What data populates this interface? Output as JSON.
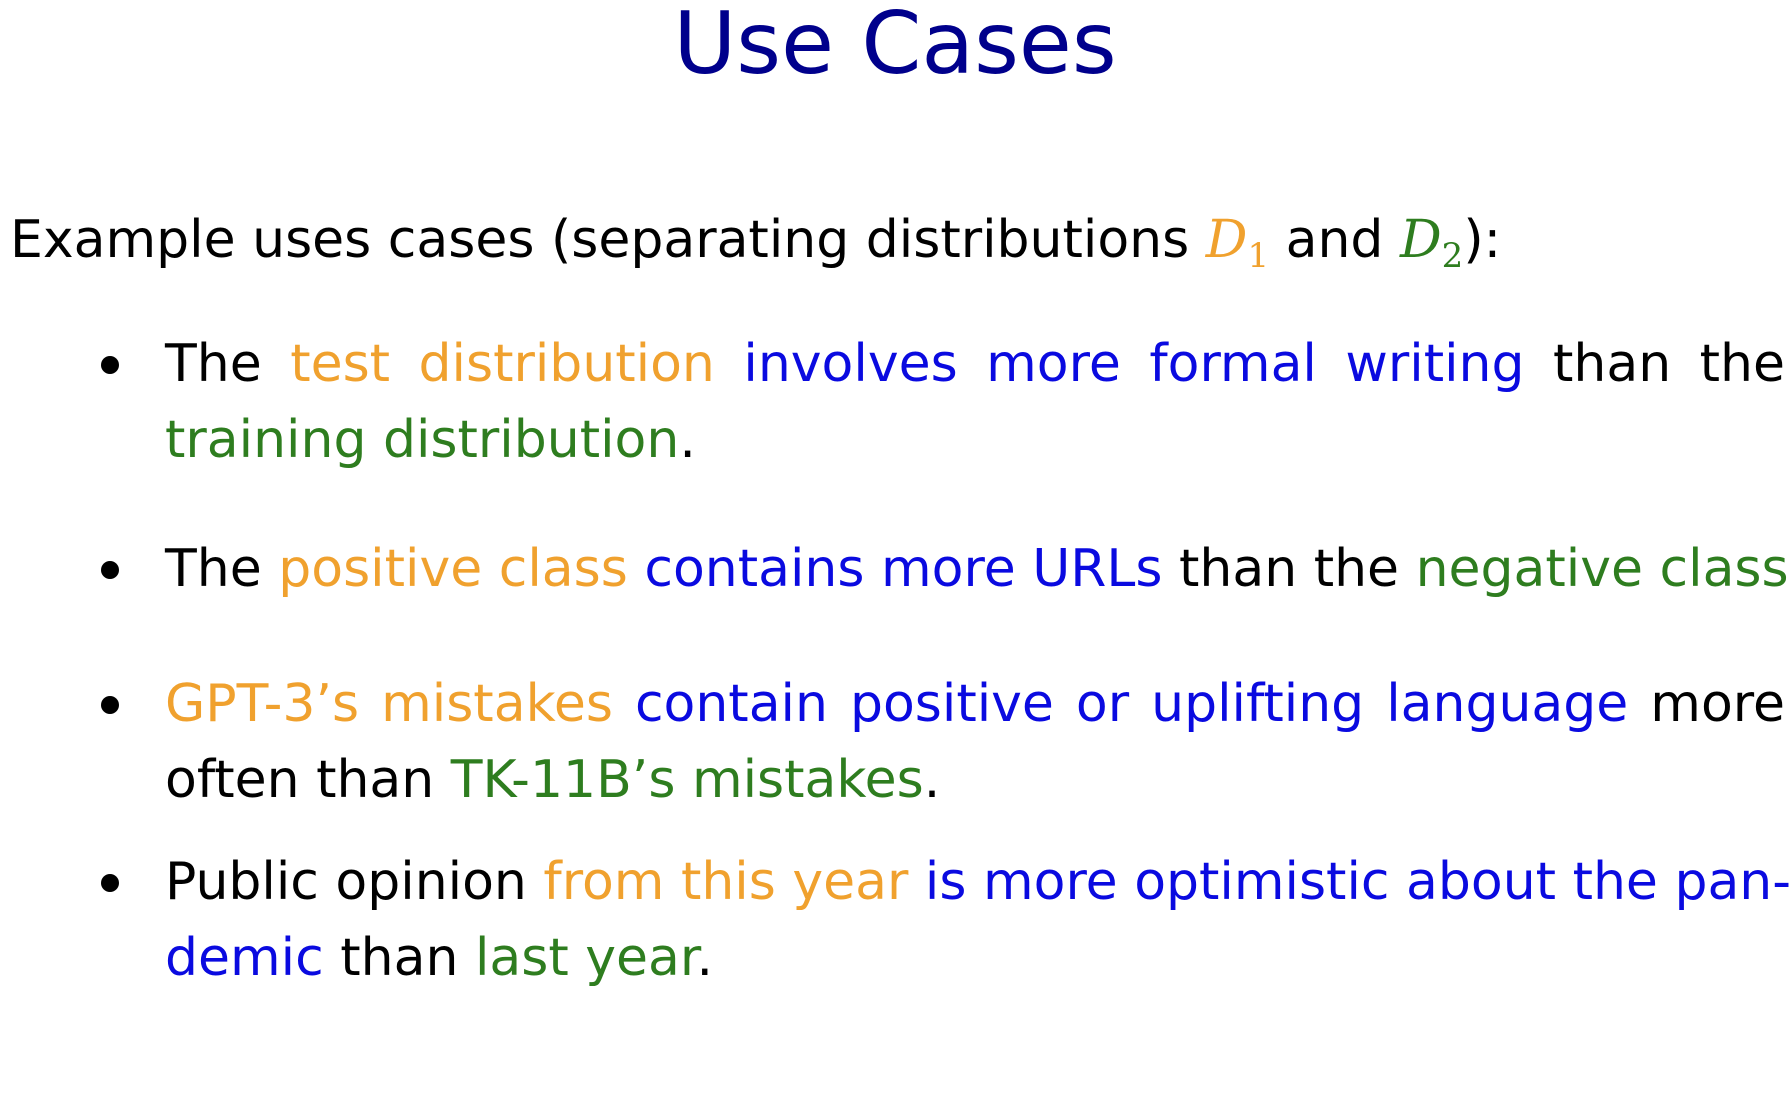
{
  "title": "Use Cases",
  "intro": {
    "prefix": "Example uses cases (separating distributions ",
    "d1": "D",
    "d1_sub": "1",
    "middle": " and ",
    "d2": "D",
    "d2_sub": "2",
    "suffix": "):"
  },
  "bullets": [
    {
      "lines": [
        [
          {
            "text": "The ",
            "color": "black"
          },
          {
            "text": "test distribution",
            "color": "orange"
          },
          {
            "text": " ",
            "color": "black"
          },
          {
            "text": "involves more formal writing",
            "color": "blue"
          },
          {
            "text": " than the",
            "color": "black"
          }
        ],
        [
          {
            "text": "training distribution",
            "color": "green"
          },
          {
            "text": ".",
            "color": "black"
          }
        ]
      ]
    },
    {
      "lines": [
        [
          {
            "text": "The ",
            "color": "black"
          },
          {
            "text": "positive class",
            "color": "orange"
          },
          {
            "text": " ",
            "color": "black"
          },
          {
            "text": "contains more URLs",
            "color": "blue"
          },
          {
            "text": " than the ",
            "color": "black"
          },
          {
            "text": "negative class",
            "color": "green"
          },
          {
            "text": ".",
            "color": "black"
          }
        ]
      ]
    },
    {
      "lines": [
        [
          {
            "text": "GPT-3’s mistakes",
            "color": "orange"
          },
          {
            "text": " ",
            "color": "black"
          },
          {
            "text": "contain positive or uplifting language",
            "color": "blue"
          },
          {
            "text": " more",
            "color": "black"
          }
        ],
        [
          {
            "text": "often than ",
            "color": "black"
          },
          {
            "text": "TK-11B’s mistakes",
            "color": "green"
          },
          {
            "text": ".",
            "color": "black"
          }
        ]
      ]
    },
    {
      "lines": [
        [
          {
            "text": "Public opinion ",
            "color": "black"
          },
          {
            "text": "from this year",
            "color": "orange"
          },
          {
            "text": " ",
            "color": "black"
          },
          {
            "text": "is more optimistic about the pan-",
            "color": "blue"
          }
        ],
        [
          {
            "text": "demic",
            "color": "blue"
          },
          {
            "text": " than ",
            "color": "black"
          },
          {
            "text": "last year",
            "color": "green"
          },
          {
            "text": ".",
            "color": "black"
          }
        ]
      ]
    }
  ],
  "colors": {
    "title": "#00008c",
    "orange": "#f0a12e",
    "blue": "#0a0ae0",
    "green": "#2e7d1f",
    "d1": "#f0a12e",
    "d2": "#2e7d1f"
  }
}
